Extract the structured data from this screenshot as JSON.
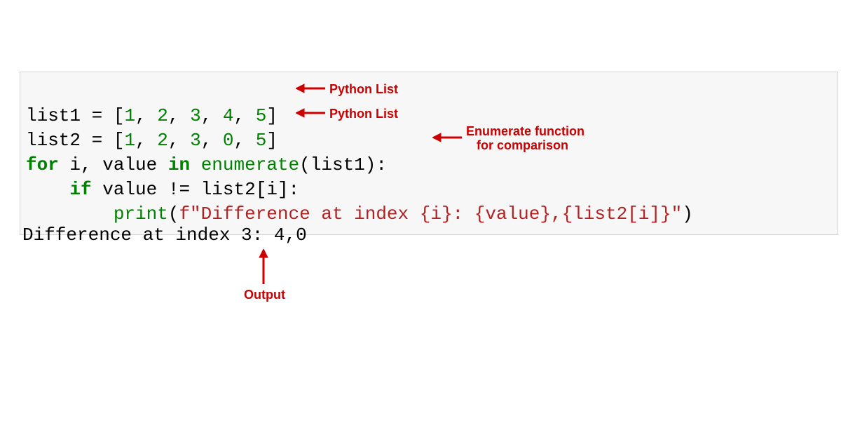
{
  "code": {
    "line1": {
      "list": "list1",
      "eq": " = ",
      "lb": "[",
      "n1": "1",
      "c1": ", ",
      "n2": "2",
      "c2": ", ",
      "n3": "3",
      "c3": ", ",
      "n4": "4",
      "c4": ", ",
      "n5": "5",
      "rb": "]"
    },
    "line2": {
      "list": "list2",
      "eq": " = ",
      "lb": "[",
      "n1": "1",
      "c1": ", ",
      "n2": "2",
      "c2": ", ",
      "n3": "3",
      "c3": ", ",
      "n4": "0",
      "c4": ", ",
      "n5": "5",
      "rb": "]"
    },
    "line3": {
      "kwfor": "for",
      "sp1": " ",
      "i": "i",
      "c1": ", ",
      "val": "value",
      "sp2": " ",
      "kwin": "in",
      "sp3": " ",
      "fn": "enumerate",
      "lp": "(",
      "arg": "list1",
      "rp": "):"
    },
    "line4": {
      "indent": "    ",
      "kwif": "if",
      "sp1": " ",
      "val": "value",
      "sp2": " ",
      "ne": "!=",
      "sp3": " ",
      "l2": "list2",
      "lb": "[",
      "i": "i",
      "rb": "]:"
    },
    "line5": {
      "indent": "        ",
      "fn": "print",
      "lp": "(",
      "f": "f\"",
      "t1": "Difference at index ",
      "ib1": "{i}",
      "t2": ": ",
      "ib2": "{value}",
      "t3": ",",
      "ib3": "{list2[i]}",
      "q": "\"",
      "rp": ")"
    }
  },
  "output": "Difference at index 3: 4,0",
  "annotations": {
    "list1": "Python List",
    "list2": "Python List",
    "enum1": "Enumerate function",
    "enum2": "for comparison",
    "output": "Output"
  },
  "colors": {
    "annotation": "#cc0000",
    "codeBg": "#f7f7f7",
    "keyword": "#008000",
    "string": "#b22222"
  }
}
